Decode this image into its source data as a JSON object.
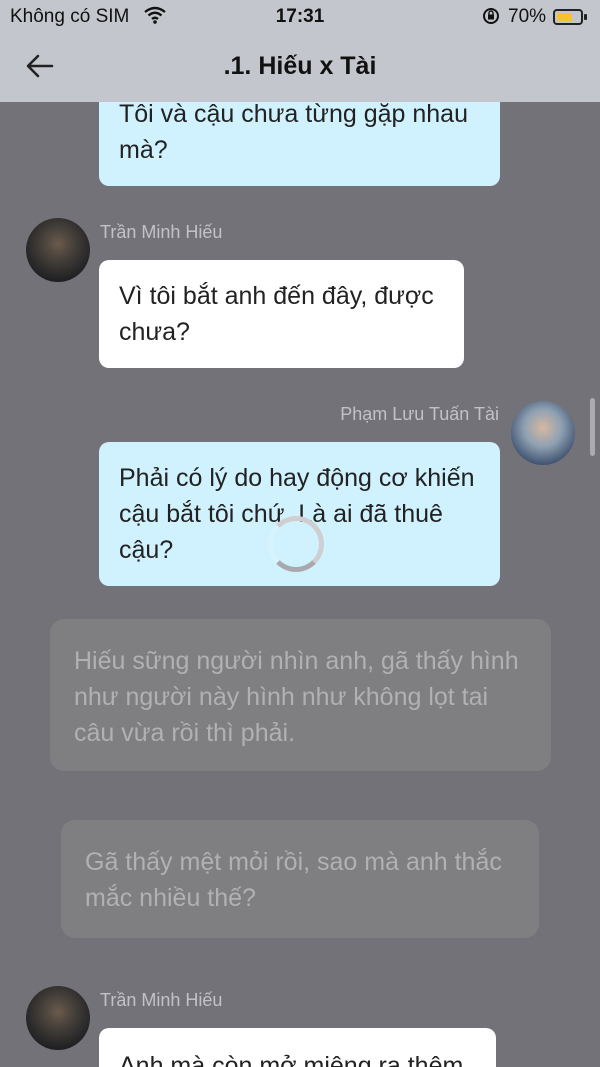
{
  "status_bar": {
    "carrier": "Không có SIM",
    "time": "17:31",
    "battery_percent": "70%",
    "battery_level": 0.7,
    "icons": [
      "wifi-icon",
      "orientation-lock-icon",
      "battery-icon"
    ]
  },
  "nav": {
    "title": ".1. Hiếu x Tài",
    "back_icon": "back-arrow-icon"
  },
  "messages": [
    {
      "type": "outgoing",
      "text": "Tôi và cậu chưa từng gặp nhau mà?"
    },
    {
      "type": "incoming",
      "sender": "Trần Minh Hiếu",
      "text": "Vì tôi bắt anh đến đây, được chưa?"
    },
    {
      "type": "outgoing",
      "sender": "Phạm Lưu Tuấn Tài",
      "text": "Phải có lý do hay động cơ khiến cậu bắt tôi chứ. Là ai đã thuê cậu?"
    },
    {
      "type": "narration",
      "text": "Hiếu sững người nhìn anh, gã thấy hình như người này hình như không lọt tai câu vừa rồi thì phải."
    },
    {
      "type": "narration",
      "text": "Gã thấy mệt mỏi rồi, sao mà anh thắc mắc nhiều thế?"
    },
    {
      "type": "incoming",
      "sender": "Trần Minh Hiếu",
      "text": "Anh mà còn mở miệng ra thêm"
    }
  ],
  "colors": {
    "background": "#737279",
    "outgoing_bubble": "#d0f1fe",
    "incoming_bubble": "#ffffff",
    "narration_bubble": "#7f7f82"
  }
}
